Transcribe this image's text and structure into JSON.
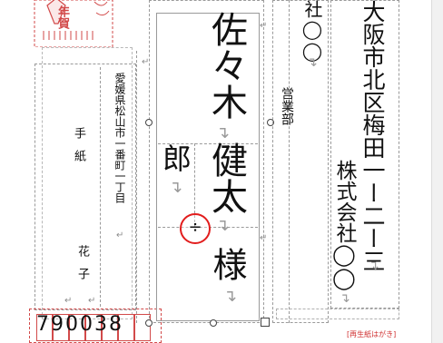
{
  "stamp": {
    "brand_text": "年賀"
  },
  "sender": {
    "address": "愛媛県松山市一番町一丁目",
    "name_line1": "手紙",
    "name_line2": "花子",
    "postal_code": "790038"
  },
  "recipient": {
    "address": "大阪市北区梅田一ー二ー三",
    "company_top": "社◯◯",
    "company": "株式会社◯◯",
    "department": "営業部",
    "surname": "佐々木",
    "given_name": "健太",
    "given_suffix": "郎",
    "honorific": "様"
  },
  "marks": {
    "paragraph": "↵",
    "newline": "↴",
    "resize_cursor": "÷"
  },
  "footer_note": "[再生紙はがき]"
}
